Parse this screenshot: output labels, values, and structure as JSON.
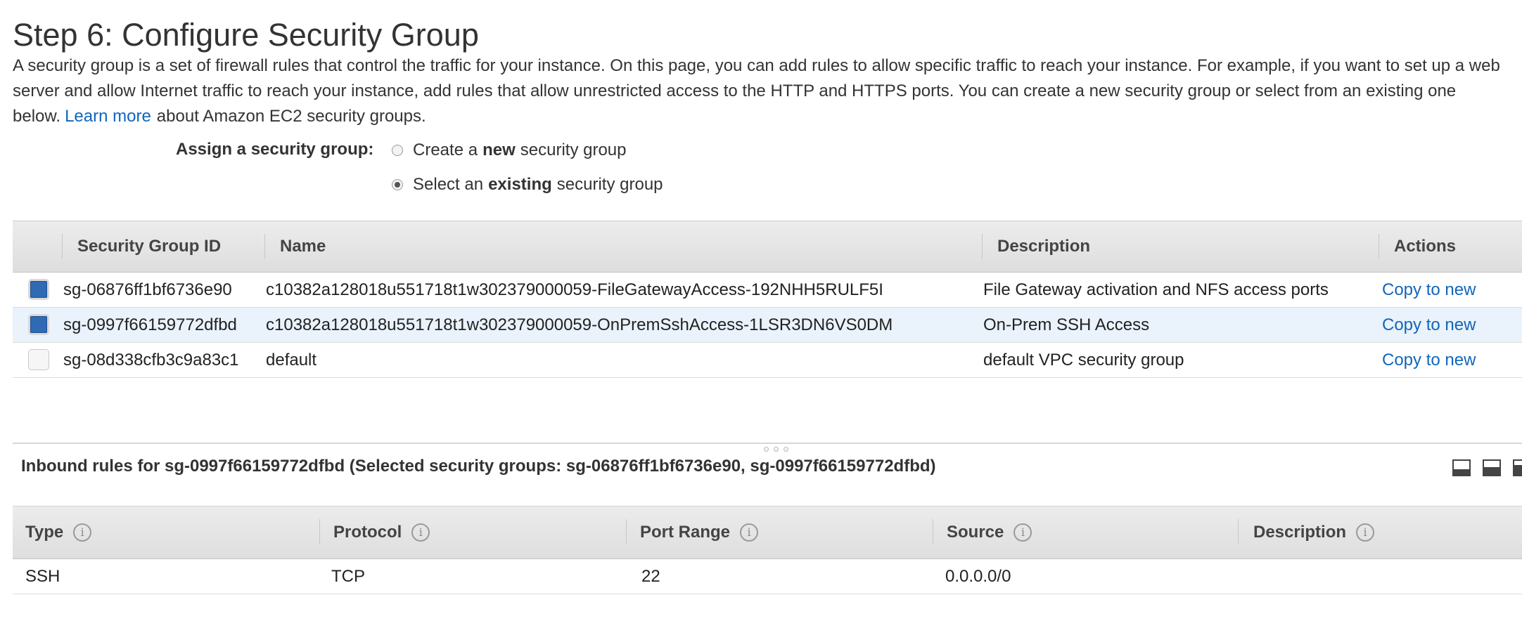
{
  "header": {
    "title": "Step 6: Configure Security Group",
    "intro_text": "A security group is a set of firewall rules that control the traffic for your instance. On this page, you can add rules to allow specific traffic to reach your instance. For example, if you want to set up a web server and allow Internet traffic to reach your instance, add rules that allow unrestricted access to the HTTP and HTTPS ports. You can create a new security group or select from an existing one below.",
    "learn_more_link": "Learn more",
    "intro_suffix": "about Amazon EC2 security groups."
  },
  "assign": {
    "label": "Assign a security group:",
    "options": [
      {
        "pre": "Create a",
        "bold": "new",
        "post": "security group",
        "selected": false
      },
      {
        "pre": "Select an",
        "bold": "existing",
        "post": "security group",
        "selected": true
      }
    ]
  },
  "security_groups": {
    "columns": [
      "Security Group ID",
      "Name",
      "Description",
      "Actions"
    ],
    "rows": [
      {
        "checked": true,
        "id": "sg-06876ff1bf6736e90",
        "name": "c10382a128018u551718t1w302379000059-FileGatewayAccess-192NHH5RULF5I",
        "description": "File Gateway activation and NFS access ports",
        "action": "Copy to new"
      },
      {
        "checked": true,
        "id": "sg-0997f66159772dfbd",
        "name": "c10382a128018u551718t1w302379000059-OnPremSshAccess-1LSR3DN6VS0DM",
        "description": "On-Prem SSH Access",
        "action": "Copy to new"
      },
      {
        "checked": false,
        "id": "sg-08d338cfb3c9a83c1",
        "name": "default",
        "description": "default VPC security group",
        "action": "Copy to new"
      }
    ]
  },
  "inbound": {
    "title": "Inbound rules for sg-0997f66159772dfbd (Selected security groups: sg-06876ff1bf6736e90, sg-0997f66159772dfbd)",
    "columns": [
      "Type",
      "Protocol",
      "Port Range",
      "Source",
      "Description"
    ],
    "info_glyph": "i",
    "rows": [
      {
        "type": "SSH",
        "protocol": "TCP",
        "port_range": "22",
        "source": "0.0.0.0/0",
        "description": ""
      }
    ]
  },
  "colors": {
    "link": "#1166bb",
    "checkbox_checked": "#2f6ab5",
    "selected_row": "#eaf2fb"
  }
}
